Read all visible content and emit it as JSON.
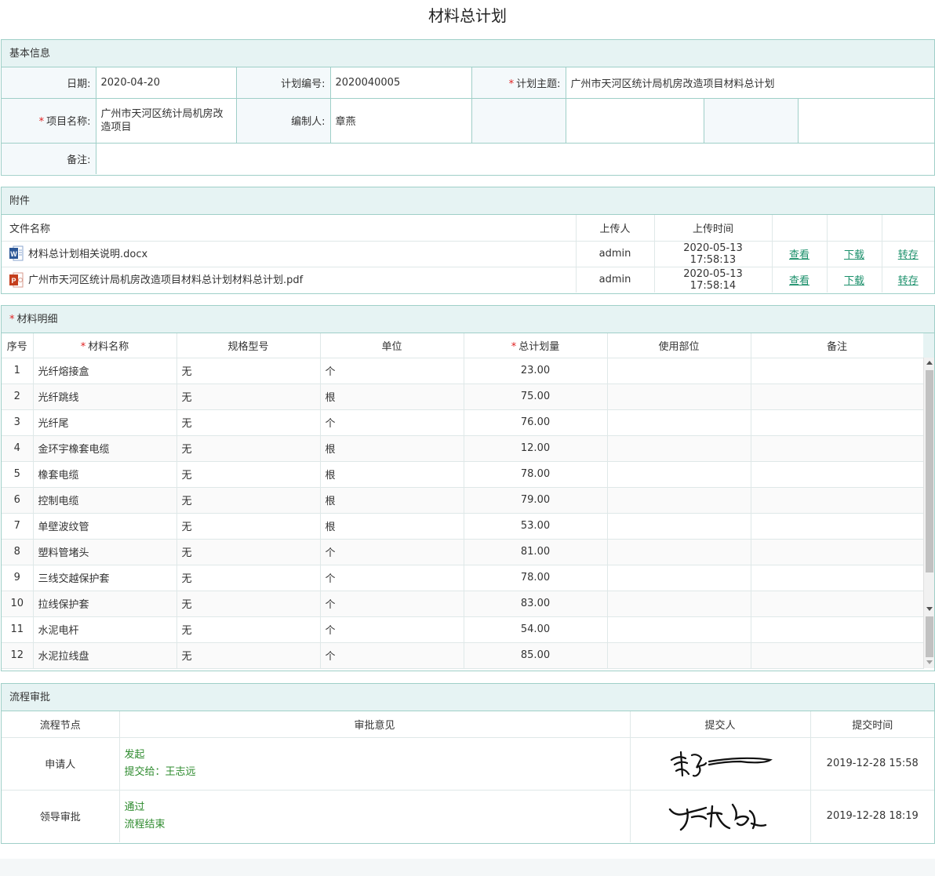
{
  "page": {
    "title": "材料总计划"
  },
  "basic_info": {
    "header": "基本信息",
    "date_label": "日期:",
    "date_value": "2020-04-20",
    "plan_no_label": "计划编号:",
    "plan_no_value": "2020040005",
    "subject_label": "计划主题:",
    "subject_value": "广州市天河区统计局机房改造项目材料总计划",
    "project_label": "项目名称:",
    "project_value": "广州市天河区统计局机房改造项目",
    "author_label": "编制人:",
    "author_value": "章燕",
    "remark_label": "备注:",
    "remark_value": ""
  },
  "attachments": {
    "header": "附件",
    "columns": {
      "name": "文件名称",
      "uploader": "上传人",
      "time": "上传时间"
    },
    "files": [
      {
        "name": "材料总计划相关说明.docx",
        "icon": "word-icon",
        "uploader": "admin",
        "time": "2020-05-13 17:58:13",
        "view": "查看",
        "download": "下载",
        "save": "转存"
      },
      {
        "name": "广州市天河区统计局机房改造项目材料总计划材料总计划.pdf",
        "icon": "pdf-icon",
        "uploader": "admin",
        "time": "2020-05-13 17:58:14",
        "view": "查看",
        "download": "下载",
        "save": "转存"
      }
    ]
  },
  "materials": {
    "header": "材料明细",
    "columns": {
      "no": "序号",
      "name": "材料名称",
      "spec": "规格型号",
      "unit": "单位",
      "qty": "总计划量",
      "location": "使用部位",
      "remark": "备注"
    },
    "rows": [
      {
        "no": "1",
        "name": "光纤熔接盒",
        "spec": "无",
        "unit": "个",
        "qty": "23.00"
      },
      {
        "no": "2",
        "name": "光纤跳线",
        "spec": "无",
        "unit": "根",
        "qty": "75.00"
      },
      {
        "no": "3",
        "name": "光纤尾",
        "spec": "无",
        "unit": "个",
        "qty": "76.00"
      },
      {
        "no": "4",
        "name": "金环宇橡套电缆",
        "spec": "无",
        "unit": "根",
        "qty": "12.00"
      },
      {
        "no": "5",
        "name": "橡套电缆",
        "spec": "无",
        "unit": "根",
        "qty": "78.00"
      },
      {
        "no": "6",
        "name": "控制电缆",
        "spec": "无",
        "unit": "根",
        "qty": "79.00"
      },
      {
        "no": "7",
        "name": "单壁波纹管",
        "spec": "无",
        "unit": "根",
        "qty": "53.00"
      },
      {
        "no": "8",
        "name": "塑料管堵头",
        "spec": "无",
        "unit": "个",
        "qty": "81.00"
      },
      {
        "no": "9",
        "name": "三线交越保护套",
        "spec": "无",
        "unit": "个",
        "qty": "78.00"
      },
      {
        "no": "10",
        "name": "拉线保护套",
        "spec": "无",
        "unit": "个",
        "qty": "83.00"
      },
      {
        "no": "11",
        "name": "水泥电杆",
        "spec": "无",
        "unit": "个",
        "qty": "54.00"
      },
      {
        "no": "12",
        "name": "水泥拉线盘",
        "spec": "无",
        "unit": "个",
        "qty": "85.00"
      }
    ]
  },
  "approval": {
    "header": "流程审批",
    "columns": {
      "node": "流程节点",
      "opinion": "审批意见",
      "submitter": "提交人",
      "time": "提交时间"
    },
    "steps": [
      {
        "node": "申请人",
        "opinion_1": "发起",
        "opinion_2": "提交给：王志远",
        "time": "2019-12-28 15:58"
      },
      {
        "node": "领导审批",
        "opinion_1": "通过",
        "opinion_2": "流程结束",
        "time": "2019-12-28 18:19"
      }
    ]
  }
}
